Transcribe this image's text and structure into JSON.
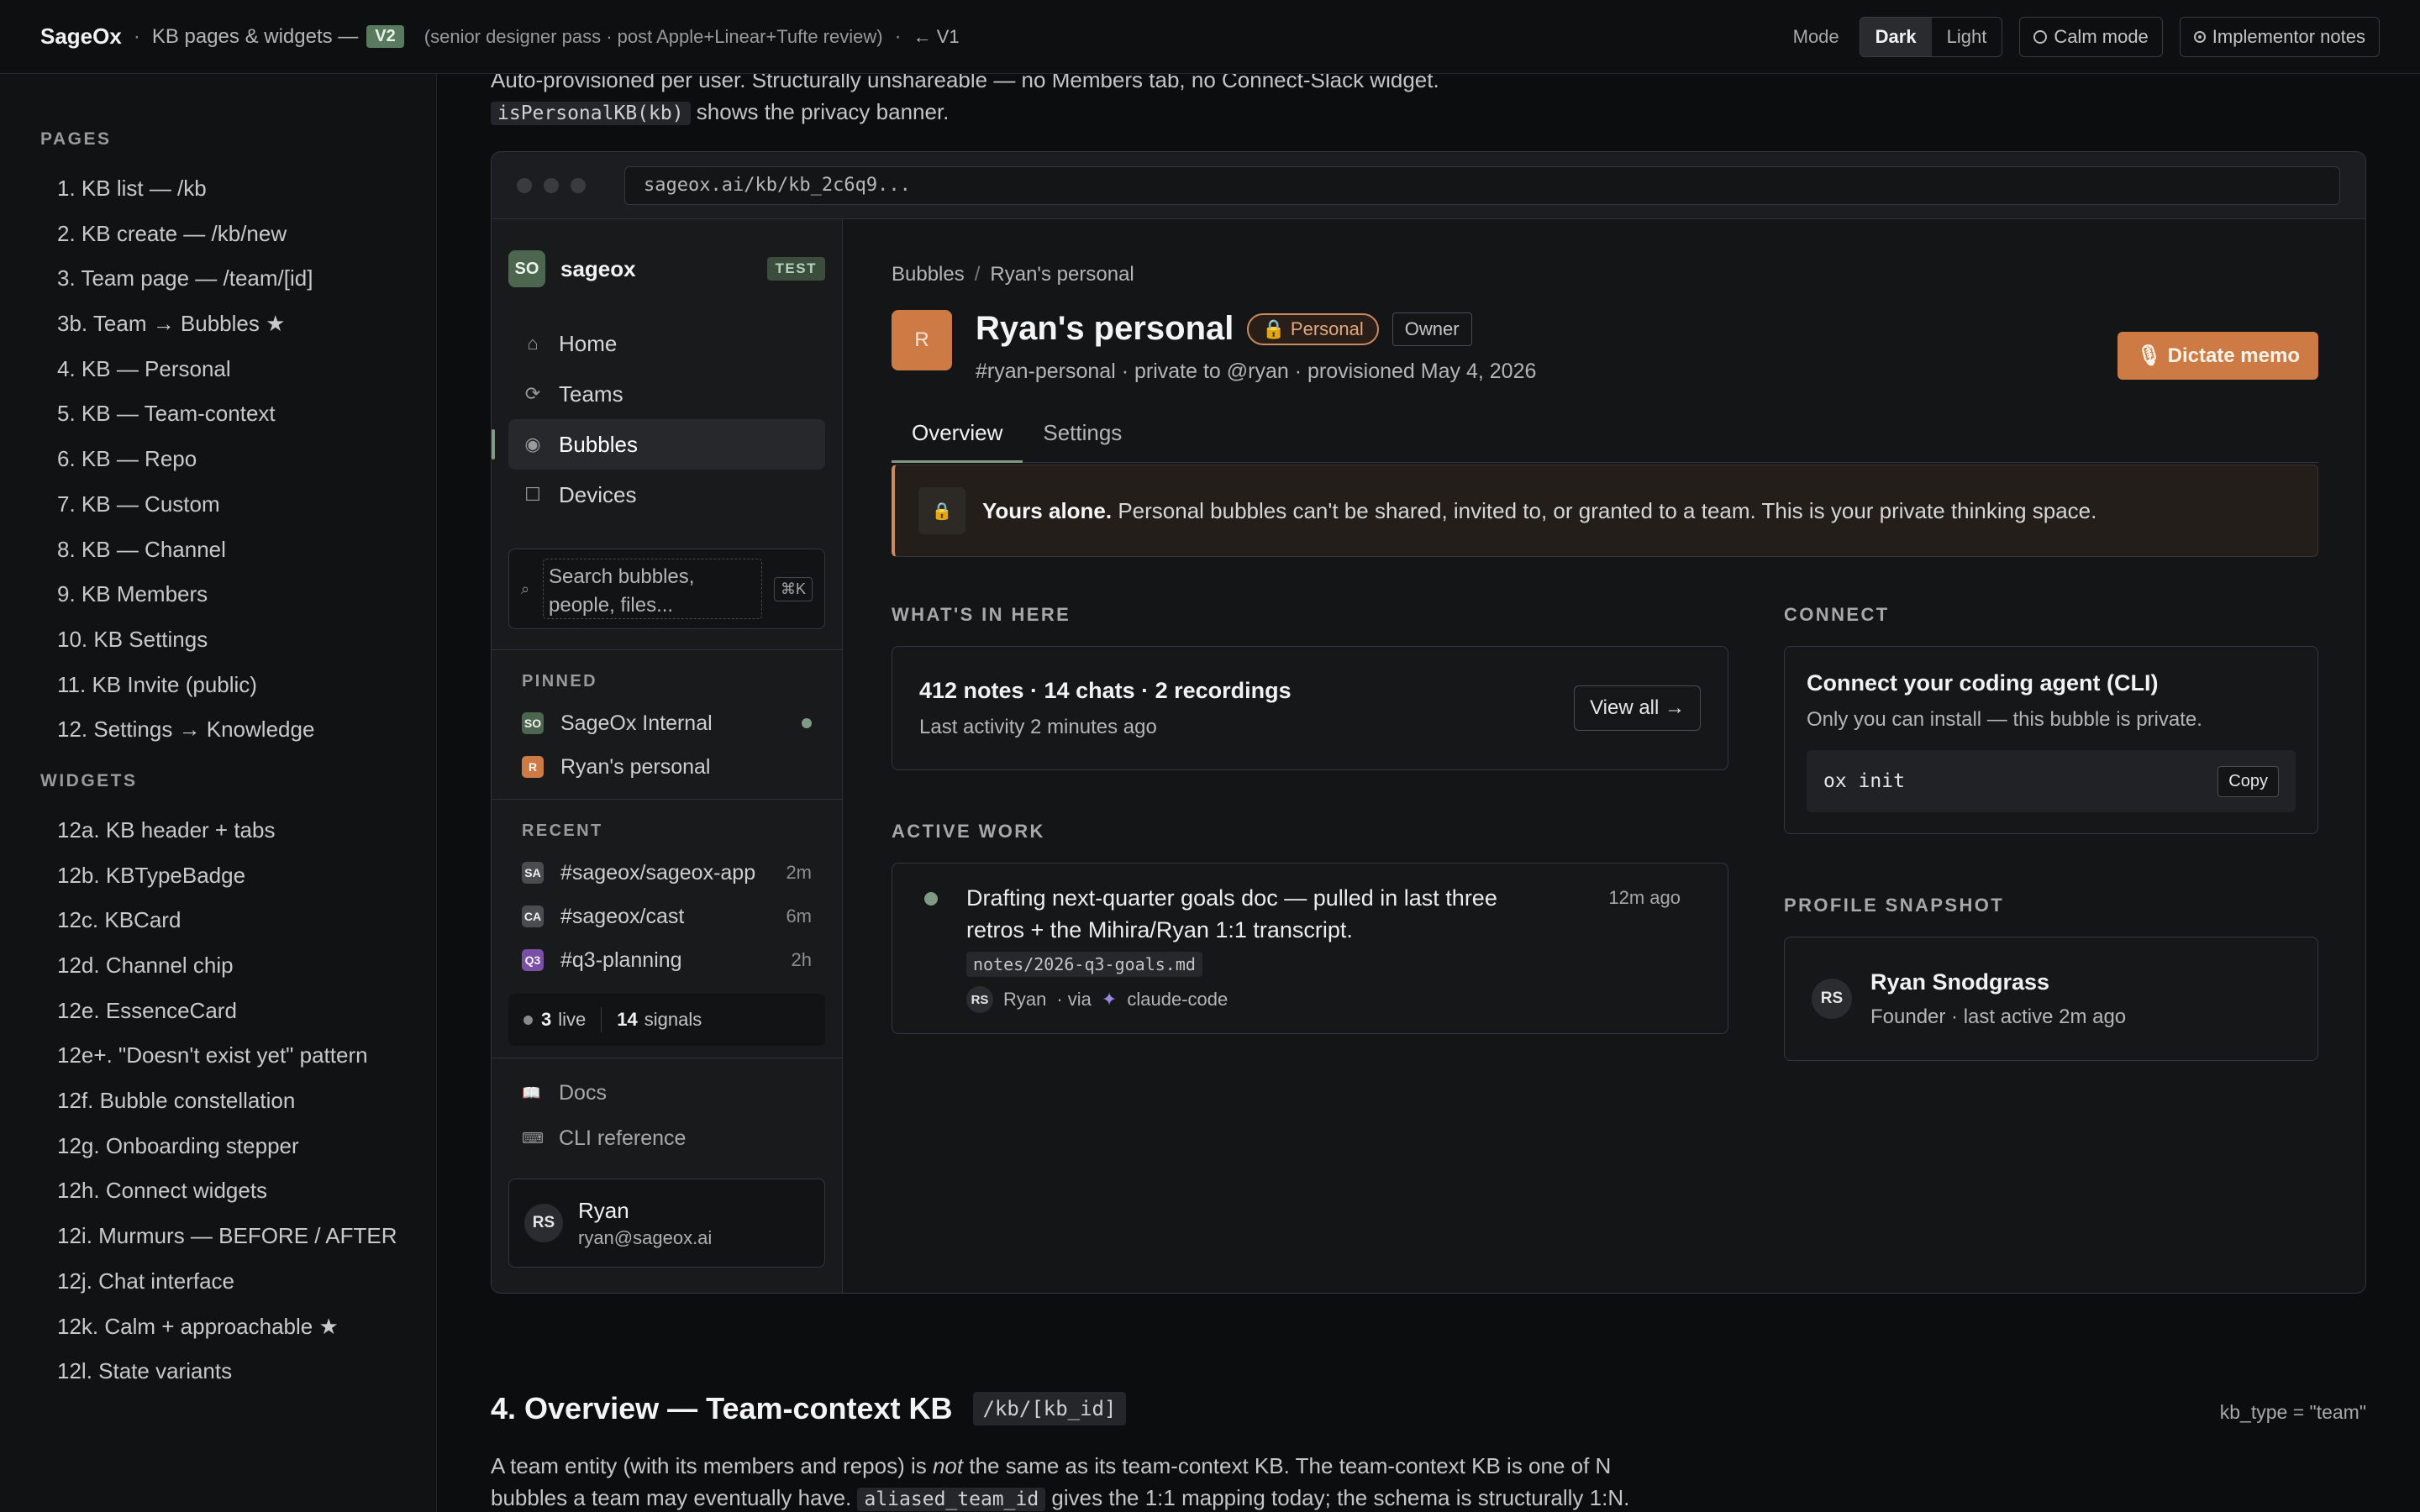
{
  "topbar": {
    "brand": "SageOx",
    "subtitle": "KB pages & widgets —",
    "version_badge": "V2",
    "note": "(senior designer pass · post Apple+Linear+Tufte review)",
    "back_link": "← V1",
    "mode_label": "Mode",
    "mode_dark": "Dark",
    "mode_light": "Light",
    "calm_mode": "Calm mode",
    "implementor_notes": "Implementor notes"
  },
  "leftnav": {
    "pages_label": "PAGES",
    "pages": [
      "1. KB list — /kb",
      "2. KB create — /kb/new",
      "3. Team page — /team/[id]",
      "3b. Team → Bubbles ★",
      "4. KB — Personal",
      "5. KB — Team-context",
      "6. KB — Repo",
      "7. KB — Custom",
      "8. KB — Channel",
      "9. KB Members",
      "10. KB Settings",
      "11. KB Invite (public)",
      "12. Settings → Knowledge"
    ],
    "widgets_label": "WIDGETS",
    "widgets": [
      "12a. KB header + tabs",
      "12b. KBTypeBadge",
      "12c. KBCard",
      "12d. Channel chip",
      "12e. EssenceCard",
      "12e+. \"Doesn't exist yet\" pattern",
      "12f. Bubble constellation",
      "12g. Onboarding stepper",
      "12h. Connect widgets",
      "12i. Murmurs — BEFORE / AFTER",
      "12j. Chat interface",
      "12k. Calm + approachable ★",
      "12l. State variants"
    ]
  },
  "intro": {
    "line1": "Auto-provisioned per user. Structurally unshareable — no Members tab, no Connect-Slack widget.",
    "code": "isPersonalKB(kb)",
    "line2_rest": " shows the privacy banner."
  },
  "browser": {
    "url": "sageox.ai/kb/kb_2c6q9..."
  },
  "sidebar": {
    "ws_badge": "SO",
    "ws_name": "sageox",
    "ws_tag": "TEST",
    "nav": [
      {
        "icon": "⌂",
        "label": "Home"
      },
      {
        "icon": "⟳",
        "label": "Teams"
      },
      {
        "icon": "◉",
        "label": "Bubbles"
      },
      {
        "icon": "☐",
        "label": "Devices"
      }
    ],
    "search_placeholder": "Search bubbles, people, files...",
    "search_kbd": "⌘K",
    "pinned_label": "PINNED",
    "pinned": [
      {
        "av": "SO",
        "label": "SageOx Internal"
      },
      {
        "av": "R",
        "label": "Ryan's personal"
      }
    ],
    "recent_label": "RECENT",
    "recent": [
      {
        "av": "SA",
        "label": "#sageox/sageox-app",
        "time": "2m"
      },
      {
        "av": "CA",
        "label": "#sageox/cast",
        "time": "6m"
      },
      {
        "av": "Q3",
        "label": "#q3-planning",
        "time": "2h"
      }
    ],
    "live_count": "3",
    "live_label": "live",
    "signals_count": "14",
    "signals_label": "signals",
    "docs": "Docs",
    "cli_ref": "CLI reference",
    "user_initials": "RS",
    "user_name": "Ryan",
    "user_email": "ryan@sageox.ai"
  },
  "page": {
    "crumb_parent": "Bubbles",
    "crumb_sep": "/",
    "crumb_current": "Ryan's personal",
    "avatar": "R",
    "title": "Ryan's personal",
    "personal_pill": "🔒 Personal",
    "owner_pill": "Owner",
    "meta": "#ryan-personal · private to @ryan · provisioned May 4, 2026",
    "dictate": "🎙 Dictate memo",
    "tab_overview": "Overview",
    "tab_settings": "Settings",
    "banner_strong": "Yours alone.",
    "banner_text": " Personal bubbles can't be shared, invited to, or granted to a team. This is your private thinking space.",
    "whats_label": "WHAT'S IN HERE",
    "stats": "412 notes · 14 chats · 2 recordings",
    "last_activity": "Last activity 2 minutes ago",
    "view_all": "View all →",
    "active_label": "ACTIVE WORK",
    "work_text": "Drafting next-quarter goals doc — pulled in last three retros + the Mihira/Ryan 1:1 transcript.",
    "work_time": "12m ago",
    "work_file": "notes/2026-q3-goals.md",
    "work_initials": "RS",
    "work_user": "Ryan",
    "work_via": "· via",
    "work_agent": "claude-code",
    "connect_label": "CONNECT",
    "connect_title": "Connect your coding agent (CLI)",
    "connect_sub": "Only you can install — this bubble is private.",
    "cmd": "ox init",
    "copy": "Copy",
    "profile_label": "PROFILE SNAPSHOT",
    "profile_initials": "RS",
    "profile_name": "Ryan Snodgrass",
    "profile_role": "Founder · last active 2m ago"
  },
  "section4": {
    "title": "4. Overview — Team-context KB",
    "route": "/kb/[kb_id]",
    "kb_type": "kb_type = \"team\"",
    "p1": "A team entity (with its members and repos) is ",
    "p1_em": "not",
    "p1_rest": " the same as its team-context KB. The team-context KB is one of N",
    "p2": "bubbles a team may eventually have. ",
    "p2_code": "aliased_team_id",
    "p2_rest": " gives the 1:1 mapping today; the schema is structurally 1:N."
  }
}
